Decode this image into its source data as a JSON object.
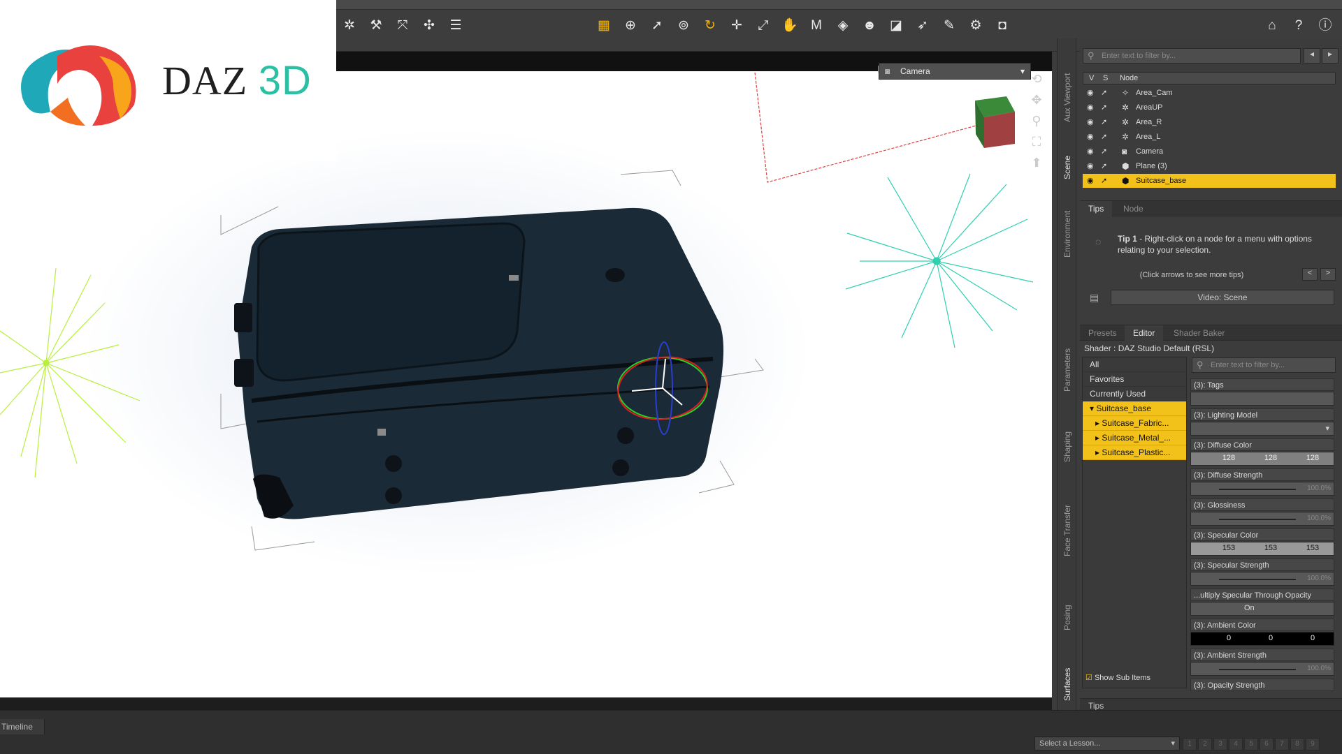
{
  "logo": {
    "brand": "DAZ",
    "suffix": "3D"
  },
  "viewport": {
    "camera_label": "Camera"
  },
  "toolbar": {
    "right_icons": [
      "home-icon",
      "help-arrow-icon",
      "help-icon"
    ]
  },
  "side_tabs": [
    "Aux Viewport",
    "Scene",
    "Environment",
    "Parameters",
    "Shaping",
    "Face Transfer",
    "Posing",
    "Surfaces"
  ],
  "scene": {
    "filter_placeholder": "Enter text to filter by...",
    "col_v": "V",
    "col_s": "S",
    "col_node": "Node",
    "nodes": [
      "Area_Cam",
      "AreaUP",
      "Area_R",
      "Area_L",
      "Camera",
      "Plane (3)",
      "Suitcase_base"
    ]
  },
  "tips": {
    "tab_tips": "Tips",
    "tab_node": "Node",
    "tip_title": "Tip 1",
    "tip_text": " - Right-click on a node for a menu with options relating to your selection.",
    "hint": "(Click arrows to see more tips)",
    "prev": "<",
    "next": ">",
    "video_label": "Video: Scene"
  },
  "surfaces": {
    "tab_presets": "Presets",
    "tab_editor": "Editor",
    "tab_shader_baker": "Shader Baker",
    "shader": "Shader : DAZ Studio Default (RSL)",
    "filter_placeholder": "Enter text to filter by...",
    "tree": [
      "All",
      "Favorites",
      "Currently Used",
      "Suitcase_base",
      "Suitcase_Fabric...",
      "Suitcase_Metal_...",
      "Suitcase_Plastic..."
    ],
    "props": {
      "tags": "(3): Tags",
      "lighting": "(3): Lighting Model",
      "diffuse_color": "(3): Diffuse Color",
      "diffuse_vals": [
        "128",
        "128",
        "128"
      ],
      "diffuse_strength": "(3): Diffuse Strength",
      "diffuse_strength_val": "100.0%",
      "glossiness": "(3): Glossiness",
      "glossiness_val": "100.0%",
      "specular_color": "(3): Specular Color",
      "specular_vals": [
        "153",
        "153",
        "153"
      ],
      "specular_strength": "(3): Specular Strength",
      "specular_strength_val": "100.0%",
      "multiply_specular": "...ultiply Specular Through Opacity",
      "multiply_val": "On",
      "ambient_color": "(3): Ambient Color",
      "ambient_vals": [
        "0",
        "0",
        "0"
      ],
      "ambient_strength": "(3): Ambient Strength",
      "ambient_strength_val": "100.0%",
      "opacity_strength": "(3): Opacity Strength"
    },
    "show_sub_items": "Show Sub Items"
  },
  "bottom": {
    "tips_tab": "Tips",
    "timeline": "Timeline",
    "lesson_placeholder": "Select a Lesson...",
    "pages": [
      "1",
      "2",
      "3",
      "4",
      "5",
      "6",
      "7",
      "8",
      "9"
    ]
  },
  "colors": {
    "accent": "#f3c21a",
    "panel": "#3c3c3c"
  }
}
